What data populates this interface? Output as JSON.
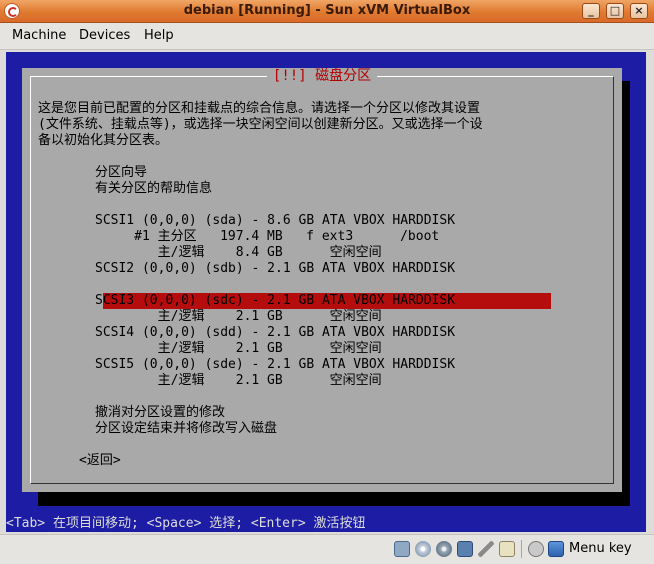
{
  "window": {
    "title": "debian [Running] - Sun xVM VirtualBox",
    "controls": {
      "minimize": "_",
      "maximize": "□",
      "close": "×"
    }
  },
  "menu": {
    "items": [
      {
        "label": "Machine"
      },
      {
        "label": "Devices"
      },
      {
        "label": "Help"
      }
    ]
  },
  "installer": {
    "dialog_title": "[!!] 磁盘分区",
    "intro_lines": [
      "这是您目前已配置的分区和挂载点的综合信息。请选择一个分区以修改其设置",
      "(文件系统、挂载点等)，或选择一块空闲空间以创建新分区。又或选择一个设",
      "备以初始化其分区表。"
    ],
    "guided": "分区向导",
    "help": "有关分区的帮助信息",
    "partition_rows": [
      "SCSI1 (0,0,0) (sda) - 8.6 GB ATA VBOX HARDDISK",
      "     #1 主分区   197.4 MB   f ext3      /boot",
      "        主/逻辑    8.4 GB      空闲空间",
      "SCSI2 (0,0,0) (sdb) - 2.1 GB ATA VBOX HARDDISK",
      "        主/逻辑    2.1 GB      空闲空间",
      "SCSI3 (0,0,0) (sdc) - 2.1 GB ATA VBOX HARDDISK",
      "        主/逻辑    2.1 GB      空闲空间",
      "SCSI4 (0,0,0) (sdd) - 2.1 GB ATA VBOX HARDDISK",
      "        主/逻辑    2.1 GB      空闲空间",
      "SCSI5 (0,0,0) (sde) - 2.1 GB ATA VBOX HARDDISK",
      "        主/逻辑    2.1 GB      空闲空间"
    ],
    "undo": "撤消对分区设置的修改",
    "finish": "分区设定结束并将修改写入磁盘",
    "back": "<返回>",
    "help_line": "<Tab> 在项目间移动; <Space> 选择; <Enter> 激活按钮"
  },
  "statusbar": {
    "icons": [
      "hdd-icon",
      "cdrom-icon",
      "floppy-icon",
      "network-icon",
      "usb-icon",
      "shared-folder-icon",
      "mouse-integration-icon"
    ],
    "host_key_label": "Menu key"
  }
}
